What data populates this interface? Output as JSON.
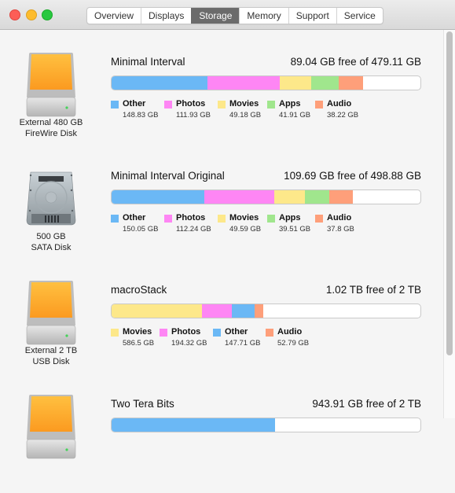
{
  "window": {
    "traffic_lights": [
      "close",
      "minimize",
      "zoom"
    ],
    "tabs": [
      {
        "label": "Overview",
        "active": false
      },
      {
        "label": "Displays",
        "active": false
      },
      {
        "label": "Storage",
        "active": true
      },
      {
        "label": "Memory",
        "active": false
      },
      {
        "label": "Support",
        "active": false
      },
      {
        "label": "Service",
        "active": false
      }
    ]
  },
  "colors": {
    "Other": "#6bb8f5",
    "Photos": "#fe86f4",
    "Movies": "#fde88a",
    "Apps": "#a0e68d",
    "Audio": "#fe9f7a"
  },
  "drives": [
    {
      "icon": "external-drive-icon",
      "label_line1": "External 480 GB",
      "label_line2": "FireWire Disk",
      "volume_name": "Minimal Interval",
      "free_text": "89.04 GB free of 479.11 GB",
      "capacity_gb": 479.11,
      "categories": [
        {
          "name": "Other",
          "value": "148.83 GB",
          "gb": 148.83
        },
        {
          "name": "Photos",
          "value": "111.93 GB",
          "gb": 111.93
        },
        {
          "name": "Movies",
          "value": "49.18 GB",
          "gb": 49.18
        },
        {
          "name": "Apps",
          "value": "41.91 GB",
          "gb": 41.91
        },
        {
          "name": "Audio",
          "value": "38.22 GB",
          "gb": 38.22
        }
      ]
    },
    {
      "icon": "internal-hard-drive-icon",
      "label_line1": "500 GB",
      "label_line2": "SATA Disk",
      "volume_name": "Minimal Interval Original",
      "free_text": "109.69 GB free of 498.88 GB",
      "capacity_gb": 498.88,
      "categories": [
        {
          "name": "Other",
          "value": "150.05 GB",
          "gb": 150.05
        },
        {
          "name": "Photos",
          "value": "112.24 GB",
          "gb": 112.24
        },
        {
          "name": "Movies",
          "value": "49.59 GB",
          "gb": 49.59
        },
        {
          "name": "Apps",
          "value": "39.51 GB",
          "gb": 39.51
        },
        {
          "name": "Audio",
          "value": "37.8 GB",
          "gb": 37.8
        }
      ]
    },
    {
      "icon": "external-drive-icon",
      "label_line1": "External 2 TB",
      "label_line2": "USB Disk",
      "volume_name": "macroStack",
      "free_text": "1.02 TB free of 2 TB",
      "capacity_gb": 2000,
      "categories": [
        {
          "name": "Movies",
          "value": "586.5 GB",
          "gb": 586.5
        },
        {
          "name": "Photos",
          "value": "194.32 GB",
          "gb": 194.32
        },
        {
          "name": "Other",
          "value": "147.71 GB",
          "gb": 147.71
        },
        {
          "name": "Audio",
          "value": "52.79 GB",
          "gb": 52.79
        }
      ]
    },
    {
      "icon": "external-drive-icon",
      "label_line1": "",
      "label_line2": "",
      "volume_name": "Two Tera Bits",
      "free_text": "943.91 GB free of 2 TB",
      "capacity_gb": 2000,
      "visible_fill": [
        {
          "name": "Other",
          "fraction": 0.53
        }
      ],
      "categories": []
    }
  ],
  "scrollbar": {
    "position_fraction": 0.0
  }
}
